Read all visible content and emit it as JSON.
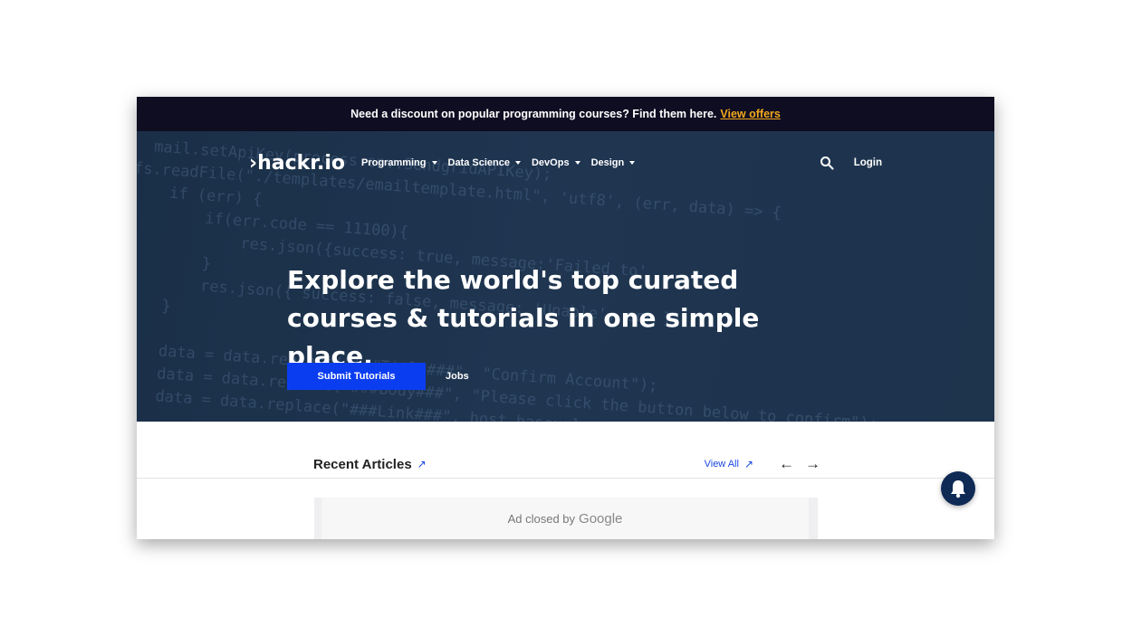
{
  "promo": {
    "text": "Need a discount on popular programming courses? Find them here.",
    "link": "View offers"
  },
  "nav": {
    "logo": "›hackr.io",
    "menu": [
      {
        "label": "Programming"
      },
      {
        "label": "Data Science"
      },
      {
        "label": "DevOps"
      },
      {
        "label": "Design"
      }
    ],
    "login": "Login",
    "search_icon": "search-icon"
  },
  "hero": {
    "headline": "Explore the world's top curated courses & tutorials in one simple place.",
    "primary_button": "Submit Tutorials",
    "secondary_button": "Jobs"
  },
  "recent": {
    "title": "Recent Articles",
    "title_icon": "↗",
    "view_all": "View All",
    "view_all_icon": "↗",
    "prev_icon": "←",
    "next_icon": "→"
  },
  "ad": {
    "text": "Ad closed by",
    "brand": "Google"
  },
  "colors": {
    "promo_bg": "#0f0d21",
    "accent_link": "#f2a81d",
    "primary_button": "#0b3df0",
    "hero_bg": "#1f3550",
    "bell_bg": "#0f2a55"
  }
}
